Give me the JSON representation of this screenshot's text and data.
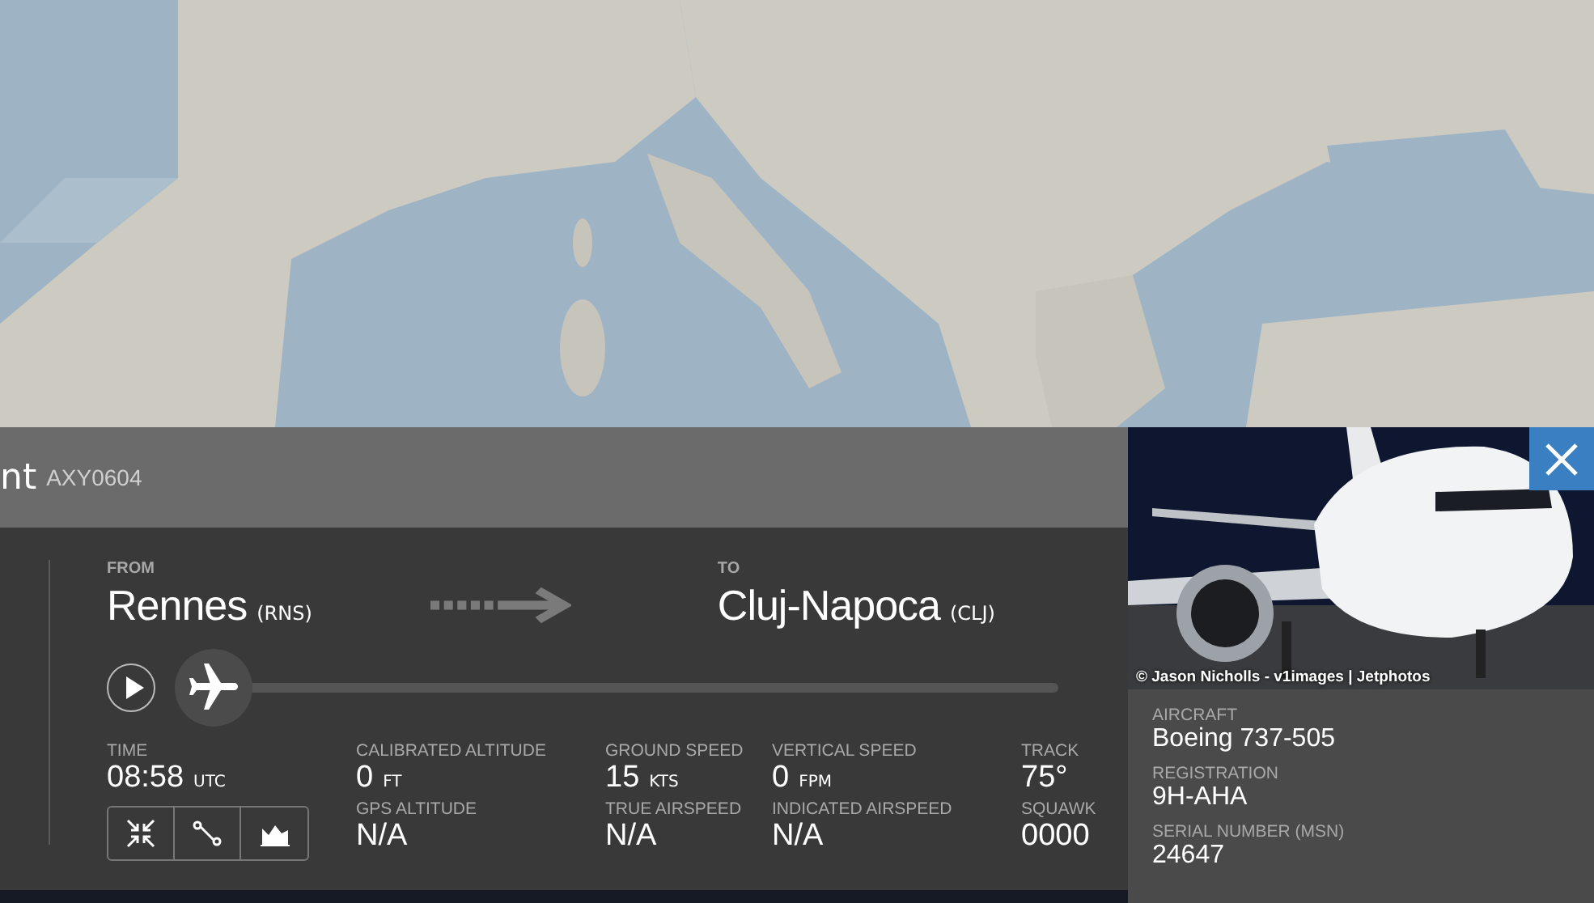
{
  "flight_panel": {
    "title": "nt",
    "callsign": "AXY0604",
    "from": {
      "label": "FROM",
      "city": "Rennes",
      "code": "(RNS)"
    },
    "to": {
      "label": "TO",
      "city": "Cluj-Napoca",
      "code": "(CLJ)"
    },
    "playback": {
      "level": 0
    },
    "stats": [
      {
        "label": "TIME",
        "value": "08:58",
        "unit": "UTC"
      },
      {
        "label": "CALIBRATED ALTITUDE",
        "value": "0",
        "unit": "FT"
      },
      {
        "label": "GROUND SPEED",
        "value": "15",
        "unit": "KTS"
      },
      {
        "label": "VERTICAL SPEED",
        "value": "0",
        "unit": "FPM"
      },
      {
        "label": "TRACK",
        "value": "75°"
      },
      {
        "label": "GPS ALTITUDE",
        "value": "N/A"
      },
      {
        "label": "TRUE AIRSPEED",
        "value": "N/A"
      },
      {
        "label": "INDICATED AIRSPEED",
        "value": "N/A"
      },
      {
        "label": "SQUAWK",
        "value": "0000"
      }
    ],
    "view_buttons": [
      {
        "kind": "collapse"
      },
      {
        "kind": "route"
      },
      {
        "kind": "graph"
      }
    ]
  },
  "aircraft_panel": {
    "photo_credit": "© Jason Nicholls - v1images | Jetphotos",
    "fields": [
      {
        "label": "AIRCRAFT",
        "value": "Boeing 737-505"
      },
      {
        "label": "REGISTRATION",
        "value": "9H-AHA"
      },
      {
        "label": "SERIAL NUMBER (MSN)",
        "value": "24647"
      }
    ]
  }
}
